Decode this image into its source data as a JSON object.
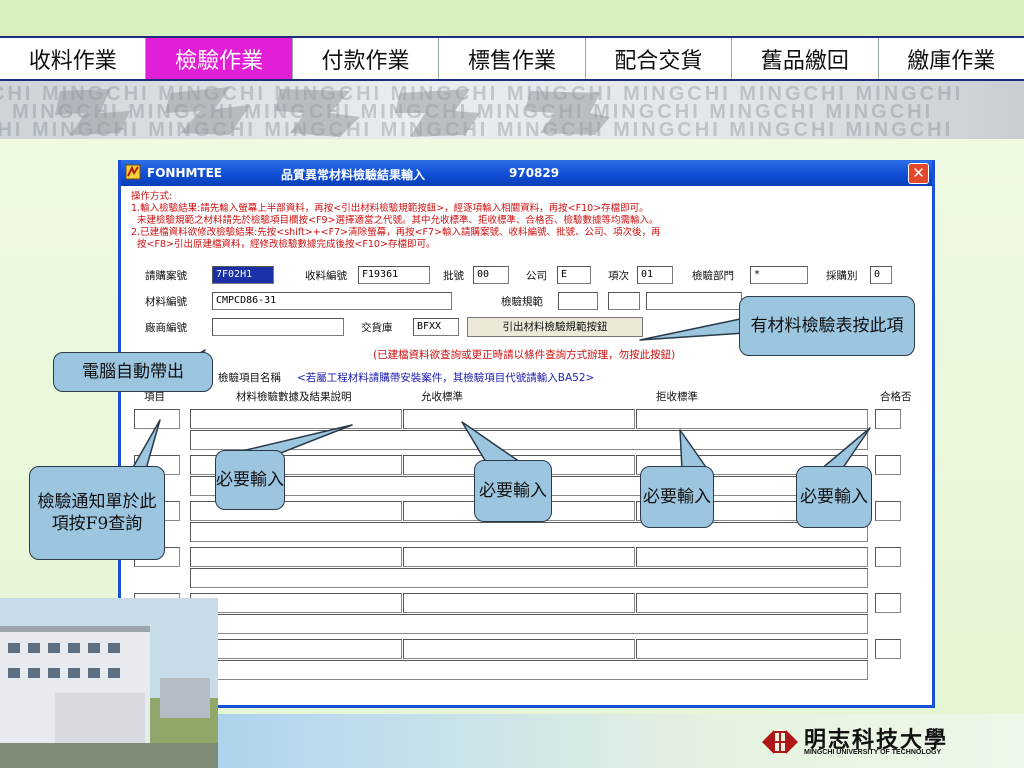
{
  "nav": {
    "tabs": [
      "收料作業",
      "檢驗作業",
      "付款作業",
      "標售作業",
      "配合交貨",
      "舊品繳回",
      "繳庫作業"
    ],
    "active": "檢驗作業"
  },
  "banner": {
    "watermark": "CHI MINGCHI MINGCHI MINGCHI MINGCHI MINGCHI MINGCHI MINGCHI MINGCHI"
  },
  "window": {
    "program_id": "FONHMTEE",
    "title": "品質異常材料檢驗結果輸入",
    "date": "970829",
    "close": "✕"
  },
  "instructions": {
    "lines": [
      "操作方式:",
      "1.輸入檢驗結果:請先輸入螢幕上半部資料，再按<引出材料檢驗規範按鈕>，經逐項輸入相關資料，再按<F10>存檔即可。",
      "  未建檢驗規範之材料請先於檢驗項目欄按<F9>選擇適當之代號。其中允收標準、拒收標準、合格否、檢驗數據等均需輸入。",
      "2.已建檔資料欲修改檢驗結果:先按<shift>+<F7>清除螢幕，再按<F7>輸入請購案號、收料編號、批號、公司、項次後，再",
      "  按<F8>引出原建檔資料，經修改檢驗數據完成後按<F10>存檔即可。"
    ]
  },
  "form": {
    "po_label": "請購案號",
    "po_value": "7F02H1",
    "recv_label": "收料編號",
    "recv_value": "F19361",
    "batch_label": "批號",
    "batch_value": "00",
    "company_label": "公司",
    "company_value": "E",
    "item_label": "項次",
    "item_value": "01",
    "dept_label": "檢驗部門",
    "dept_value": "*",
    "buyer_label": "採購別",
    "buyer_value": "0",
    "material_label": "材料編號",
    "material_value": "CMPCD86-31",
    "spec_label": "檢驗規範",
    "vendor_label": "廠商編號",
    "warehouse_label": "交貨庫",
    "warehouse_value": "BFXX",
    "spec_button": "引出材料檢驗規範按鈕",
    "query_note": "(已建檔資料欲查詢或更正時請以條件查詢方式辦理，勿按此按鈕)",
    "item_name_label": "檢驗項目名稱",
    "item_name_note": "<若屬工程材料請購帶安裝案件，其檢驗項目代號請輸入BA52>"
  },
  "table": {
    "headers": {
      "item": "項目",
      "data": "材料檢驗數據及結果說明",
      "accept": "允收標準",
      "reject": "拒收標準",
      "pass": "合格否"
    }
  },
  "callouts": {
    "spec_button": "有材料檢驗表按此項",
    "auto": "電腦自動帶出",
    "f9": "檢驗通知單於此項按F9查詢",
    "required": "必要輸入"
  },
  "logo": {
    "name": "明志科技大學",
    "sub": "MINGCHI UNIVERSITY OF TECHNOLOGY"
  },
  "colors": {
    "active_tab": "#e11fd6",
    "title_bar": "#0e4cd2",
    "callout": "#9cc5df",
    "instruction_text": "#d01010"
  }
}
